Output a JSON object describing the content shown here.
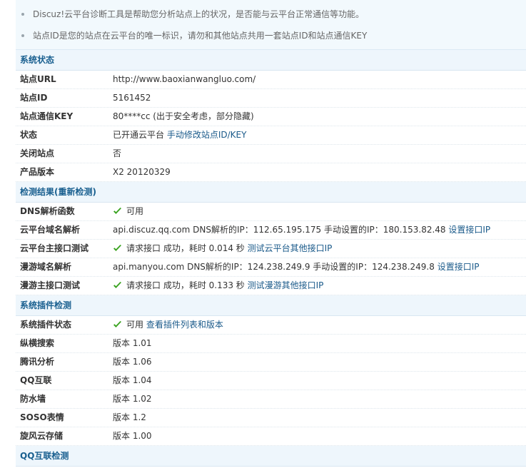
{
  "tips": [
    "Discuz!云平台诊断工具是帮助您分析站点上的状况，是否能与云平台正常通信等功能。",
    "站点ID是您的站点在云平台的唯一标识，请勿和其他站点共用一套站点ID和站点通信KEY"
  ],
  "status_section": {
    "title": "系统状态",
    "rows": [
      {
        "label": "站点URL",
        "value": "http://www.baoxianwangluo.com/"
      },
      {
        "label": "站点ID",
        "value": "5161452"
      },
      {
        "label": "站点通信KEY",
        "value": "80****cc (出于安全考虑，部分隐藏)"
      },
      {
        "label": "状态",
        "value": "已开通云平台",
        "link": "手动修改站点ID/KEY"
      },
      {
        "label": "关闭站点",
        "value": "否"
      },
      {
        "label": "产品版本",
        "value": "X2 20120329"
      }
    ]
  },
  "detect_section": {
    "title_prefix": "检测结果(",
    "title_link": "重新检测",
    "title_suffix": ")",
    "rows": [
      {
        "label": "DNS解析函数",
        "value": "可用",
        "check": true
      },
      {
        "label": "云平台域名解析",
        "value": "api.discuz.qq.com DNS解析的IP：112.65.195.175 手动设置的IP：180.153.82.48",
        "link": "设置接口IP"
      },
      {
        "label": "云平台主接口测试",
        "value": "请求接口 成功，耗时 0.014 秒",
        "link": "测试云平台其他接口IP",
        "check": true
      },
      {
        "label": "漫游域名解析",
        "value": "api.manyou.com DNS解析的IP：124.238.249.9 手动设置的IP：124.238.249.8",
        "link": "设置接口IP"
      },
      {
        "label": "漫游主接口测试",
        "value": "请求接口 成功，耗时 0.133 秒",
        "link": "测试漫游其他接口IP",
        "check": true
      }
    ]
  },
  "plugin_section": {
    "title": "系统插件检测",
    "rows": [
      {
        "label": "系统插件状态",
        "value": "可用",
        "link": "查看插件列表和版本",
        "check": true
      },
      {
        "label": "纵横搜索",
        "value": "版本 1.01"
      },
      {
        "label": "腾讯分析",
        "value": "版本 1.06"
      },
      {
        "label": "QQ互联",
        "value": "版本 1.04"
      },
      {
        "label": "防水墙",
        "value": "版本 1.02"
      },
      {
        "label": "SOSO表情",
        "value": "版本 1.2"
      },
      {
        "label": "旋风云存储",
        "value": "版本 1.00"
      }
    ]
  },
  "qq_section": {
    "title": "QQ互联检测"
  },
  "icons": {
    "check": "check-icon",
    "bullet": "bullet-icon"
  },
  "colors": {
    "link": "#1a5a8a",
    "check_green": "#3aa320",
    "header_bg": "#eef6fc"
  }
}
